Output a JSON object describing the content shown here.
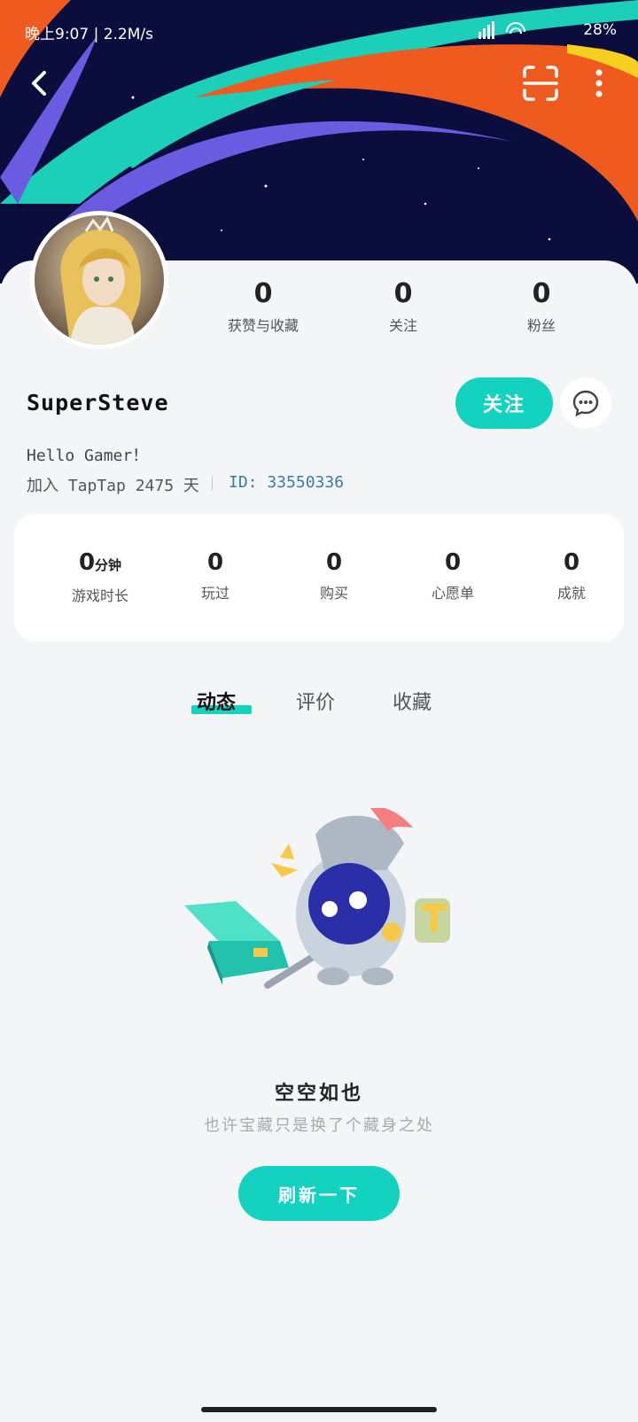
{
  "status_bar": {
    "time": "晚上9:07 | 2.2M/s",
    "battery": "28%"
  },
  "header": {
    "back_icon": "chevron-left-icon",
    "scan_icon": "scan-icon",
    "more_icon": "more-vertical-icon",
    "banner_colors": [
      "#0b0d3d",
      "#1ccfb8",
      "#ef5b1e",
      "#6b5be0",
      "#f5d020"
    ]
  },
  "profile": {
    "username": "SuperSteve",
    "bio": "Hello Gamer！",
    "joined": "加入 TapTap 2475 天",
    "id": "ID: 33550336",
    "follow_label": "关注",
    "message_icon": "chat-bubble-icon",
    "stats": [
      {
        "value": "0",
        "label": "获赞与收藏"
      },
      {
        "value": "0",
        "label": "关注"
      },
      {
        "value": "0",
        "label": "粉丝"
      }
    ]
  },
  "game_stats": [
    {
      "value": "0",
      "unit": "分钟",
      "label": "游戏时长"
    },
    {
      "value": "0",
      "unit": "",
      "label": "玩过"
    },
    {
      "value": "0",
      "unit": "",
      "label": "购买"
    },
    {
      "value": "0",
      "unit": "",
      "label": "心愿单"
    },
    {
      "value": "0",
      "unit": "",
      "label": "成就"
    }
  ],
  "tabs": [
    {
      "label": "动态",
      "active": true
    },
    {
      "label": "评价",
      "active": false
    },
    {
      "label": "收藏",
      "active": false
    }
  ],
  "empty_state": {
    "title": "空空如也",
    "subtitle": "也许宝藏只是换了个藏身之处",
    "refresh_label": "刷新一下"
  },
  "colors": {
    "accent": "#14d2c0",
    "background": "#f3f5f7"
  }
}
